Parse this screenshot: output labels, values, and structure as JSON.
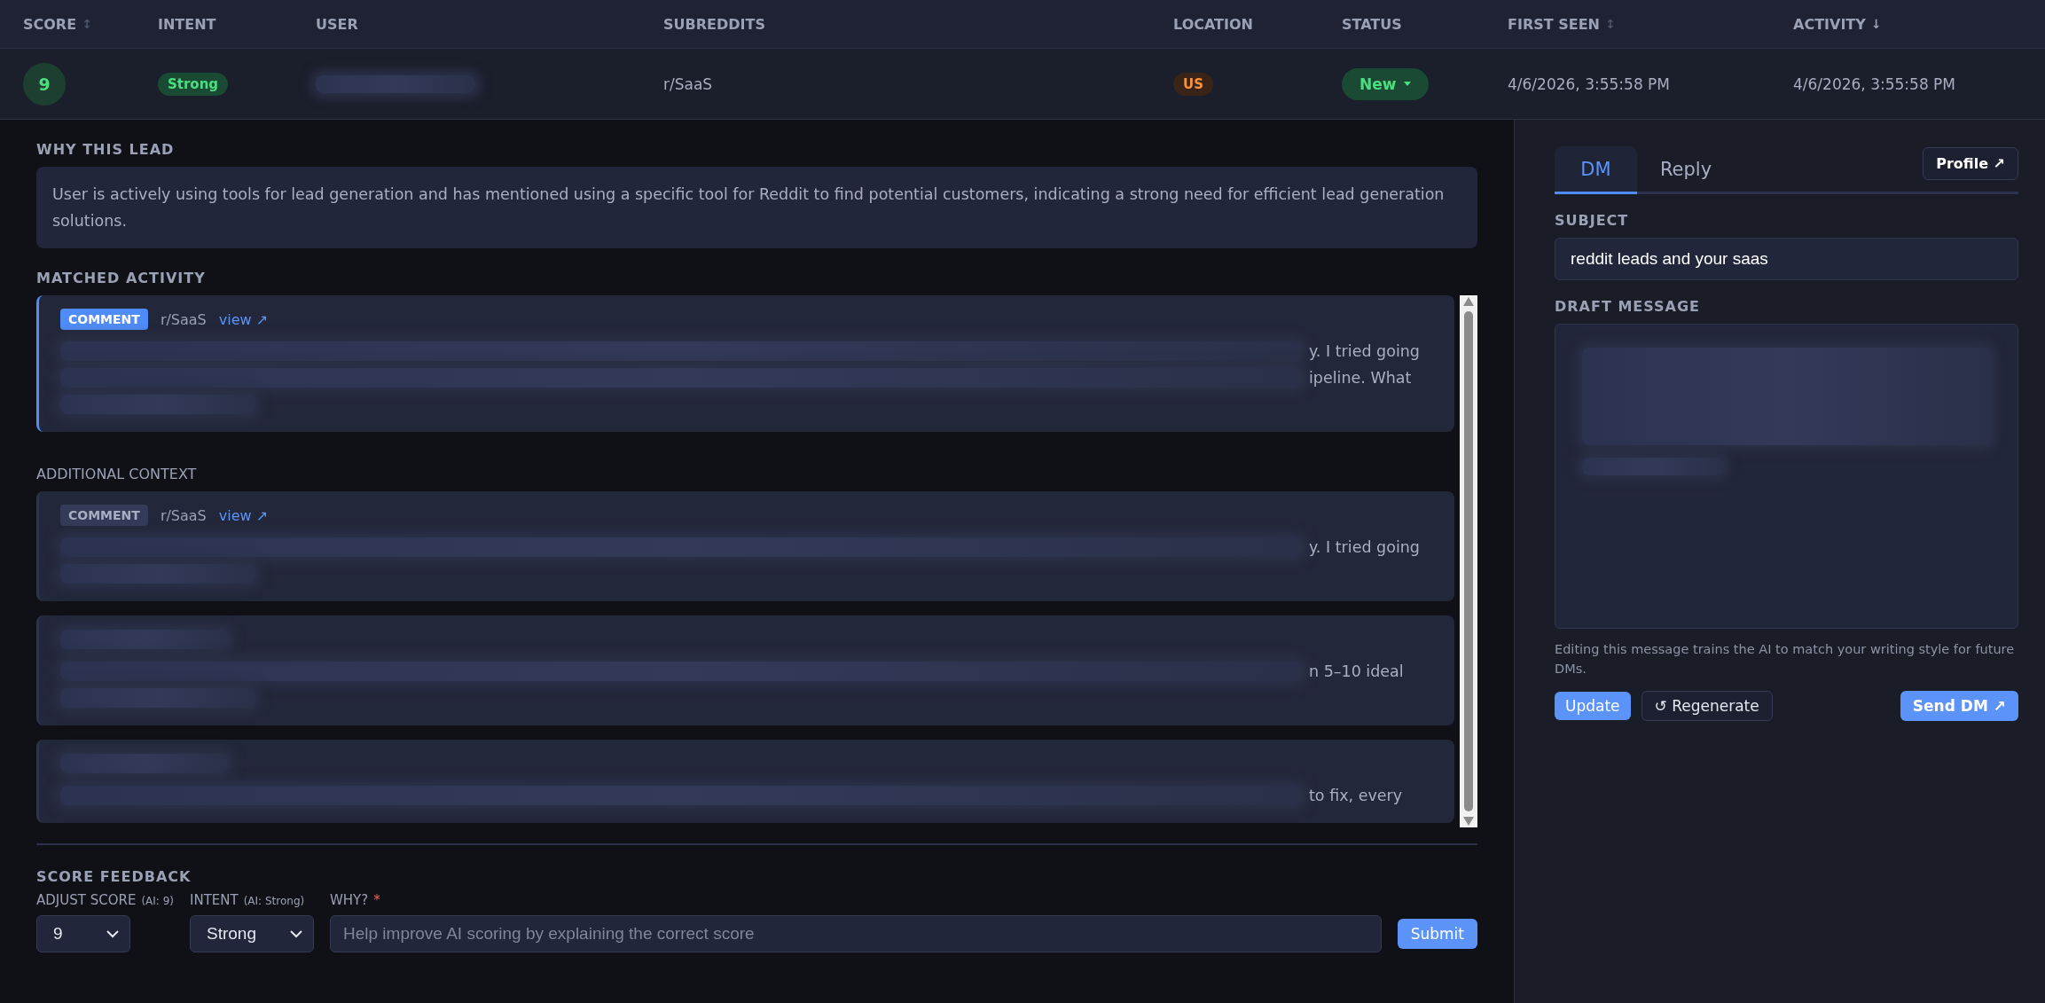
{
  "table": {
    "columns": [
      {
        "label": "SCORE",
        "sort_icon": "↕"
      },
      {
        "label": "INTENT"
      },
      {
        "label": "USER"
      },
      {
        "label": "SUBREDDITS"
      },
      {
        "label": "LOCATION"
      },
      {
        "label": "STATUS"
      },
      {
        "label": "FIRST SEEN",
        "sort_icon": "↕"
      },
      {
        "label": "ACTIVITY",
        "sort_icon": "↓"
      }
    ],
    "row": {
      "score": "9",
      "intent": "Strong",
      "subreddit": "r/SaaS",
      "location": "US",
      "status": "New",
      "first_seen": "4/6/2026, 3:55:58 PM",
      "activity": "4/6/2026, 3:55:58 PM"
    }
  },
  "why": {
    "title": "WHY THIS LEAD",
    "text": "User is actively using tools for lead generation and has mentioned using a specific tool for Reddit to find potential customers, indicating a strong need for efficient lead generation solutions."
  },
  "matched": {
    "title": "MATCHED ACTIVITY",
    "cards": [
      {
        "kind": "comment",
        "type": "COMMENT",
        "subreddit": "r/SaaS",
        "link": "view ↗",
        "highlighted": true,
        "lines": [
          {
            "kind": "text",
            "tail": "y. I tried going"
          },
          {
            "kind": "text",
            "tail": "ipeline. What"
          },
          {
            "kind": "blur"
          }
        ]
      }
    ]
  },
  "additional": {
    "title": "ADDITIONAL CONTEXT",
    "cards": [
      {
        "kind": "comment",
        "type": "COMMENT",
        "subreddit": "r/SaaS",
        "link": "view ↗",
        "highlighted": false,
        "lines": [
          {
            "kind": "text",
            "tail": "y. I tried going"
          },
          {
            "kind": "blur"
          }
        ]
      },
      {
        "kind": "hidden",
        "highlighted": false,
        "lines": [
          {
            "kind": "text",
            "tail": "n 5–10 ideal"
          },
          {
            "kind": "blur"
          }
        ]
      },
      {
        "kind": "hidden",
        "highlighted": false,
        "lines": [
          {
            "kind": "text",
            "tail": "to fix, every"
          }
        ]
      }
    ]
  },
  "feedback": {
    "title": "SCORE FEEDBACK",
    "score_label": "ADJUST SCORE",
    "score_hint": "(AI: 9)",
    "score_value": "9",
    "intent_label": "INTENT",
    "intent_hint": "(AI: Strong)",
    "intent_value": "Strong",
    "why_label": "WHY?",
    "required_mark": "*",
    "placeholder": "Help improve AI scoring by explaining the correct score",
    "submit": "Submit"
  },
  "compose": {
    "tabs": [
      {
        "label": "DM",
        "selected": true
      },
      {
        "label": "Reply",
        "selected": false
      }
    ],
    "profile": "Profile ↗",
    "subject_label": "SUBJECT",
    "subject": "reddit leads and your saas",
    "draft_label": "DRAFT MESSAGE",
    "help": "Editing this message trains the AI to match your writing style for future DMs.",
    "update": "Update",
    "regenerate": "↺ Regenerate",
    "send": "Send DM ↗"
  }
}
